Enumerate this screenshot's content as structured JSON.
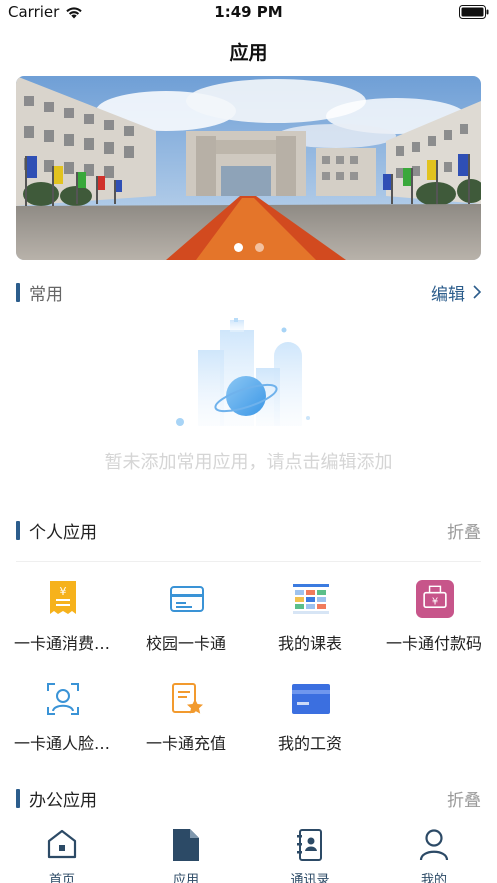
{
  "status_bar": {
    "carrier": "Carrier",
    "time": "1:49 PM"
  },
  "nav": {
    "title": "应用"
  },
  "banner": {
    "slides": 2,
    "active_slide": 1
  },
  "common": {
    "title": "常用",
    "action": "编辑",
    "empty_text": "暂未添加常用应用，请点击编辑添加"
  },
  "personal": {
    "title": "个人应用",
    "action": "折叠",
    "apps": [
      {
        "label": "一卡通消费…",
        "icon": "receipt-icon"
      },
      {
        "label": "校园一卡通",
        "icon": "card-icon"
      },
      {
        "label": "我的课表",
        "icon": "timetable-icon"
      },
      {
        "label": "一卡通付款码",
        "icon": "payment-code-icon"
      },
      {
        "label": "一卡通人脸…",
        "icon": "face-scan-icon"
      },
      {
        "label": "一卡通充值",
        "icon": "recharge-icon"
      },
      {
        "label": "我的工资",
        "icon": "salary-icon"
      }
    ]
  },
  "office": {
    "title": "办公应用",
    "action": "折叠"
  },
  "tabs": [
    {
      "label": "首页",
      "icon": "home-icon"
    },
    {
      "label": "应用",
      "icon": "apps-icon"
    },
    {
      "label": "通讯录",
      "icon": "contacts-icon"
    },
    {
      "label": "我的",
      "icon": "profile-icon"
    }
  ],
  "colors": {
    "accent": "#2c5d8c",
    "muted": "#9a9a9a",
    "empty_text": "#d5d5d5"
  }
}
